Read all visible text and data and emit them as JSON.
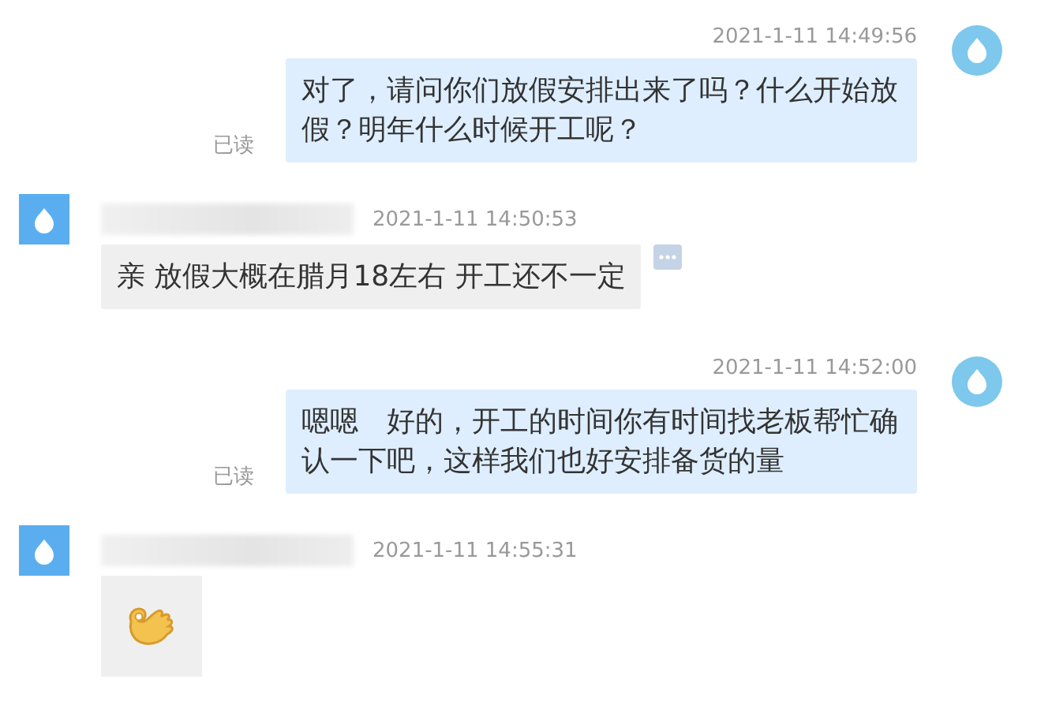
{
  "messages": [
    {
      "kind": "outgoing",
      "time": "2021-1-11 14:49:56",
      "text": "对了，请问你们放假安排出来了吗？什么开始放假？明年什么时候开工呢？",
      "status": "已读"
    },
    {
      "kind": "incoming",
      "time": "2021-1-11 14:50:53",
      "text": "亲 放假大概在腊月18左右 开工还不一定",
      "more": true
    },
    {
      "kind": "outgoing",
      "time": "2021-1-11 14:52:00",
      "text": "嗯嗯　好的，开工的时间你有时间找老板帮忙确认一下吧，这样我们也好安排备货的量",
      "status": "已读"
    },
    {
      "kind": "incoming_sticker",
      "time": "2021-1-11 14:55:31",
      "more": false
    }
  ]
}
